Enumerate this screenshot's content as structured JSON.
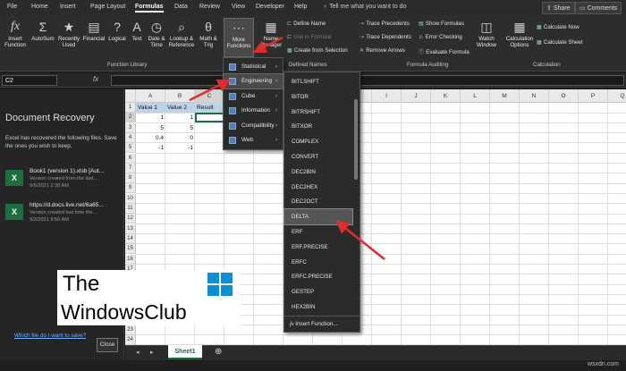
{
  "ribbon_tabs": [
    "File",
    "Home",
    "Insert",
    "Page Layout",
    "Formulas",
    "Data",
    "Review",
    "View",
    "Developer",
    "Help"
  ],
  "tell_me": "Tell me what you want to do",
  "share": "Share",
  "comments": "Comments",
  "ribbon": {
    "insert_function": "Insert Function",
    "autosum": "AutoSum",
    "recently_used": "Recently Used",
    "financial": "Financial",
    "logical": "Logical",
    "text": "Text",
    "date_time": "Date & Time",
    "lookup": "Lookup & Reference",
    "math": "Math & Trig",
    "more_functions": "More Functions",
    "name_manager": "Name Manager",
    "define_name": "Define Name",
    "use_in_formula": "Use in Formula",
    "create_from_selection": "Create from Selection",
    "trace_precedents": "Trace Precedents",
    "trace_dependents": "Trace Dependents",
    "remove_arrows": "Remove Arrows",
    "show_formulas": "Show Formulas",
    "error_checking": "Error Checking",
    "evaluate_formula": "Evaluate Formula",
    "watch_window": "Watch Window",
    "calc_options": "Calculation Options",
    "calc_now": "Calculate Now",
    "calc_sheet": "Calculate Sheet",
    "groups": {
      "function_library": "Function Library",
      "defined_names": "Defined Names",
      "formula_auditing": "Formula Auditing",
      "calculation": "Calculation"
    }
  },
  "formula_bar": {
    "name_box": "C2",
    "fx": "fx"
  },
  "recovery": {
    "title": "Document Recovery",
    "description": "Excel has recovered the following files. Save the ones you wish to keep.",
    "files": [
      {
        "name": "Book1 (version 1).xlsb [Aut...",
        "desc": "Version created from the last...",
        "time": "9/6/2021 2:38 AM"
      },
      {
        "name": "https://d.docs.live.net/6a65...",
        "desc": "Version created last time the...",
        "time": "9/3/2021 9:56 AM"
      }
    ],
    "which_file": "Which file do I want to save?",
    "close": "Close"
  },
  "watermark": {
    "line1": "The",
    "line2": "WindowsClub"
  },
  "grid": {
    "columns": [
      "A",
      "B",
      "C",
      "D",
      "E",
      "F",
      "G",
      "H",
      "I",
      "J",
      "K",
      "L",
      "M",
      "N",
      "O",
      "P",
      "Q"
    ],
    "rows": [
      "1",
      "2",
      "3",
      "4",
      "5",
      "6",
      "7",
      "8",
      "9",
      "10",
      "11",
      "12",
      "13",
      "14",
      "15",
      "16",
      "17",
      "18",
      "19",
      "20",
      "21",
      "22",
      "23",
      "24"
    ],
    "headers": [
      "Value 1",
      "Value 2",
      "Result"
    ],
    "data": [
      [
        "1",
        "1"
      ],
      [
        "5",
        "5"
      ],
      [
        "0.4",
        "0"
      ],
      [
        "-1",
        "-1"
      ]
    ]
  },
  "sheet_tab": "Sheet1",
  "more_functions_menu": [
    "Statistical",
    "Engineering",
    "Cube",
    "Information",
    "Compatibility",
    "Web"
  ],
  "engineering_menu": [
    "BITLSHIFT",
    "BITOR",
    "BITRSHIFT",
    "BITXOR",
    "COMPLEX",
    "CONVERT",
    "DEC2BIN",
    "DEC2HEX",
    "DEC2OCT",
    "DELTA",
    "ERF",
    "ERF.PRECISE",
    "ERFC",
    "ERFC.PRECISE",
    "GESTEP",
    "HEX2BIN"
  ],
  "insert_function_item": "Insert Function...",
  "watermark_site": "wsxdn.com",
  "colors": {
    "excel_green": "#1d6f42",
    "arrow_red": "#e32b2b",
    "link_blue": "#6fb3ff"
  }
}
